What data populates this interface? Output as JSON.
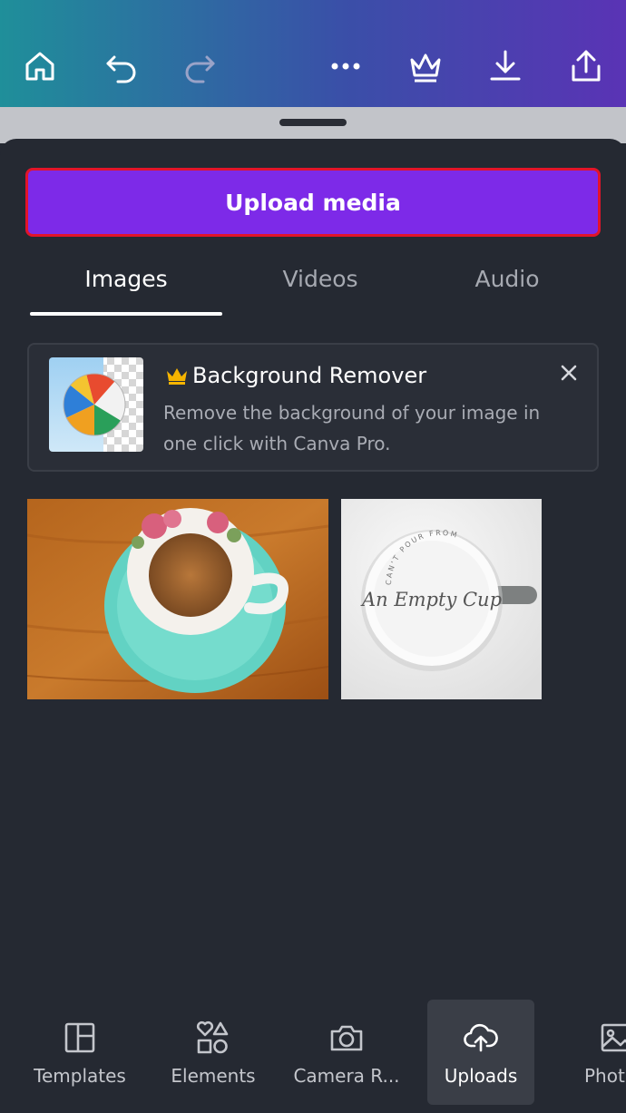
{
  "toolbar": {
    "icons": [
      "home-icon",
      "undo-icon",
      "redo-icon",
      "more-icon",
      "crown-icon",
      "download-icon",
      "share-icon"
    ]
  },
  "upload": {
    "label": "Upload media"
  },
  "tabs": [
    {
      "label": "Images",
      "active": true
    },
    {
      "label": "Videos",
      "active": false
    },
    {
      "label": "Audio",
      "active": false
    }
  ],
  "promo": {
    "title": "Background Remover",
    "description": "Remove the background of your image in one click with Canva Pro."
  },
  "images": [
    {
      "name": "teacup-saucer"
    },
    {
      "name": "empty-cup",
      "text": "An Empty Cup",
      "arc_text": "CAN'T POUR FROM"
    }
  ],
  "bottom_nav": [
    {
      "label": "Templates",
      "icon": "templates-icon"
    },
    {
      "label": "Elements",
      "icon": "elements-icon"
    },
    {
      "label": "Camera R...",
      "icon": "camera-icon"
    },
    {
      "label": "Uploads",
      "icon": "upload-cloud-icon",
      "active": true
    },
    {
      "label": "Phot",
      "icon": "photos-icon"
    }
  ],
  "colors": {
    "accent": "#7d2ae8",
    "highlight_border": "#e2142a",
    "panel": "#252932",
    "crown": "#f5b400"
  }
}
